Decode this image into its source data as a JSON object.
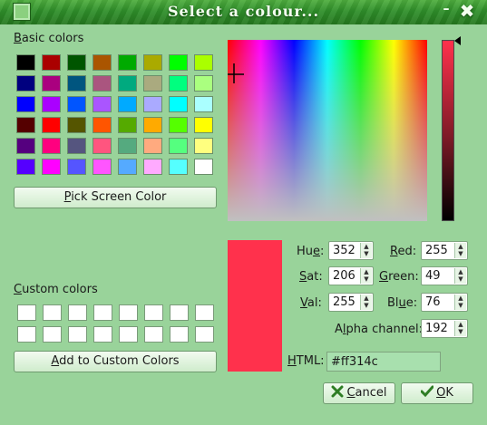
{
  "window": {
    "title": "Select a colour...",
    "minimize_glyph": "–",
    "close_glyph": "✖"
  },
  "basic_colors": {
    "label_prefix": "B",
    "label_rest": "asic colors",
    "swatches": [
      [
        "#000000",
        "#aa0000",
        "#005500",
        "#aa5500",
        "#00aa00",
        "#aaaa00",
        "#00ff00",
        "#aaff00"
      ],
      [
        "#00007f",
        "#aa007f",
        "#00557f",
        "#aa557f",
        "#00aa7f",
        "#aaaa7f",
        "#00ff7f",
        "#aaff7f"
      ],
      [
        "#0000ff",
        "#aa00ff",
        "#0055ff",
        "#aa55ff",
        "#00aaff",
        "#aaaaff",
        "#00ffff",
        "#aaffff"
      ],
      [
        "#550000",
        "#ff0000",
        "#555500",
        "#ff5500",
        "#55aa00",
        "#ffaa00",
        "#55ff00",
        "#ffff00"
      ],
      [
        "#55007f",
        "#ff007f",
        "#55557f",
        "#ff557f",
        "#55aa7f",
        "#ffaa7f",
        "#55ff7f",
        "#ffff7f"
      ],
      [
        "#5500ff",
        "#ff00ff",
        "#5555ff",
        "#ff55ff",
        "#55aaff",
        "#ffaaff",
        "#55ffff",
        "#ffffff"
      ]
    ]
  },
  "pick_screen_color": {
    "prefix": "P",
    "rest": "ick Screen Color"
  },
  "custom_colors": {
    "label_prefix": "C",
    "label_rest": "ustom colors",
    "rows": 2,
    "cols": 8
  },
  "add_custom": {
    "prefix": "A",
    "rest": "dd to Custom Colors"
  },
  "current_color": "#ff314c",
  "fields": {
    "hue": {
      "prefix": "Hu",
      "key": "e",
      "suffix": ":",
      "value": "352"
    },
    "sat": {
      "prefix": "",
      "key": "S",
      "suffix": "at:",
      "value": "206"
    },
    "val": {
      "prefix": "",
      "key": "V",
      "suffix": "al:",
      "value": "255"
    },
    "red": {
      "prefix": "",
      "key": "R",
      "suffix": "ed:",
      "value": "255"
    },
    "green": {
      "prefix": "",
      "key": "G",
      "suffix": "reen:",
      "value": "49"
    },
    "blue": {
      "prefix": "Bl",
      "key": "u",
      "suffix": "e:",
      "value": "76"
    },
    "alpha": {
      "prefix": "A",
      "key": "l",
      "suffix": "pha channel:",
      "value": "192"
    }
  },
  "html": {
    "prefix": "",
    "key": "H",
    "suffix": "TML:",
    "value": "#ff314c"
  },
  "buttons": {
    "cancel": "Cancel",
    "ok": "OK",
    "cancel_key": "C",
    "cancel_rest": "ancel",
    "ok_key": "O",
    "ok_rest": "K"
  },
  "icons": {
    "cancel": "cancel-x-icon",
    "ok": "checkmark-icon",
    "app": "app-window-icon"
  }
}
